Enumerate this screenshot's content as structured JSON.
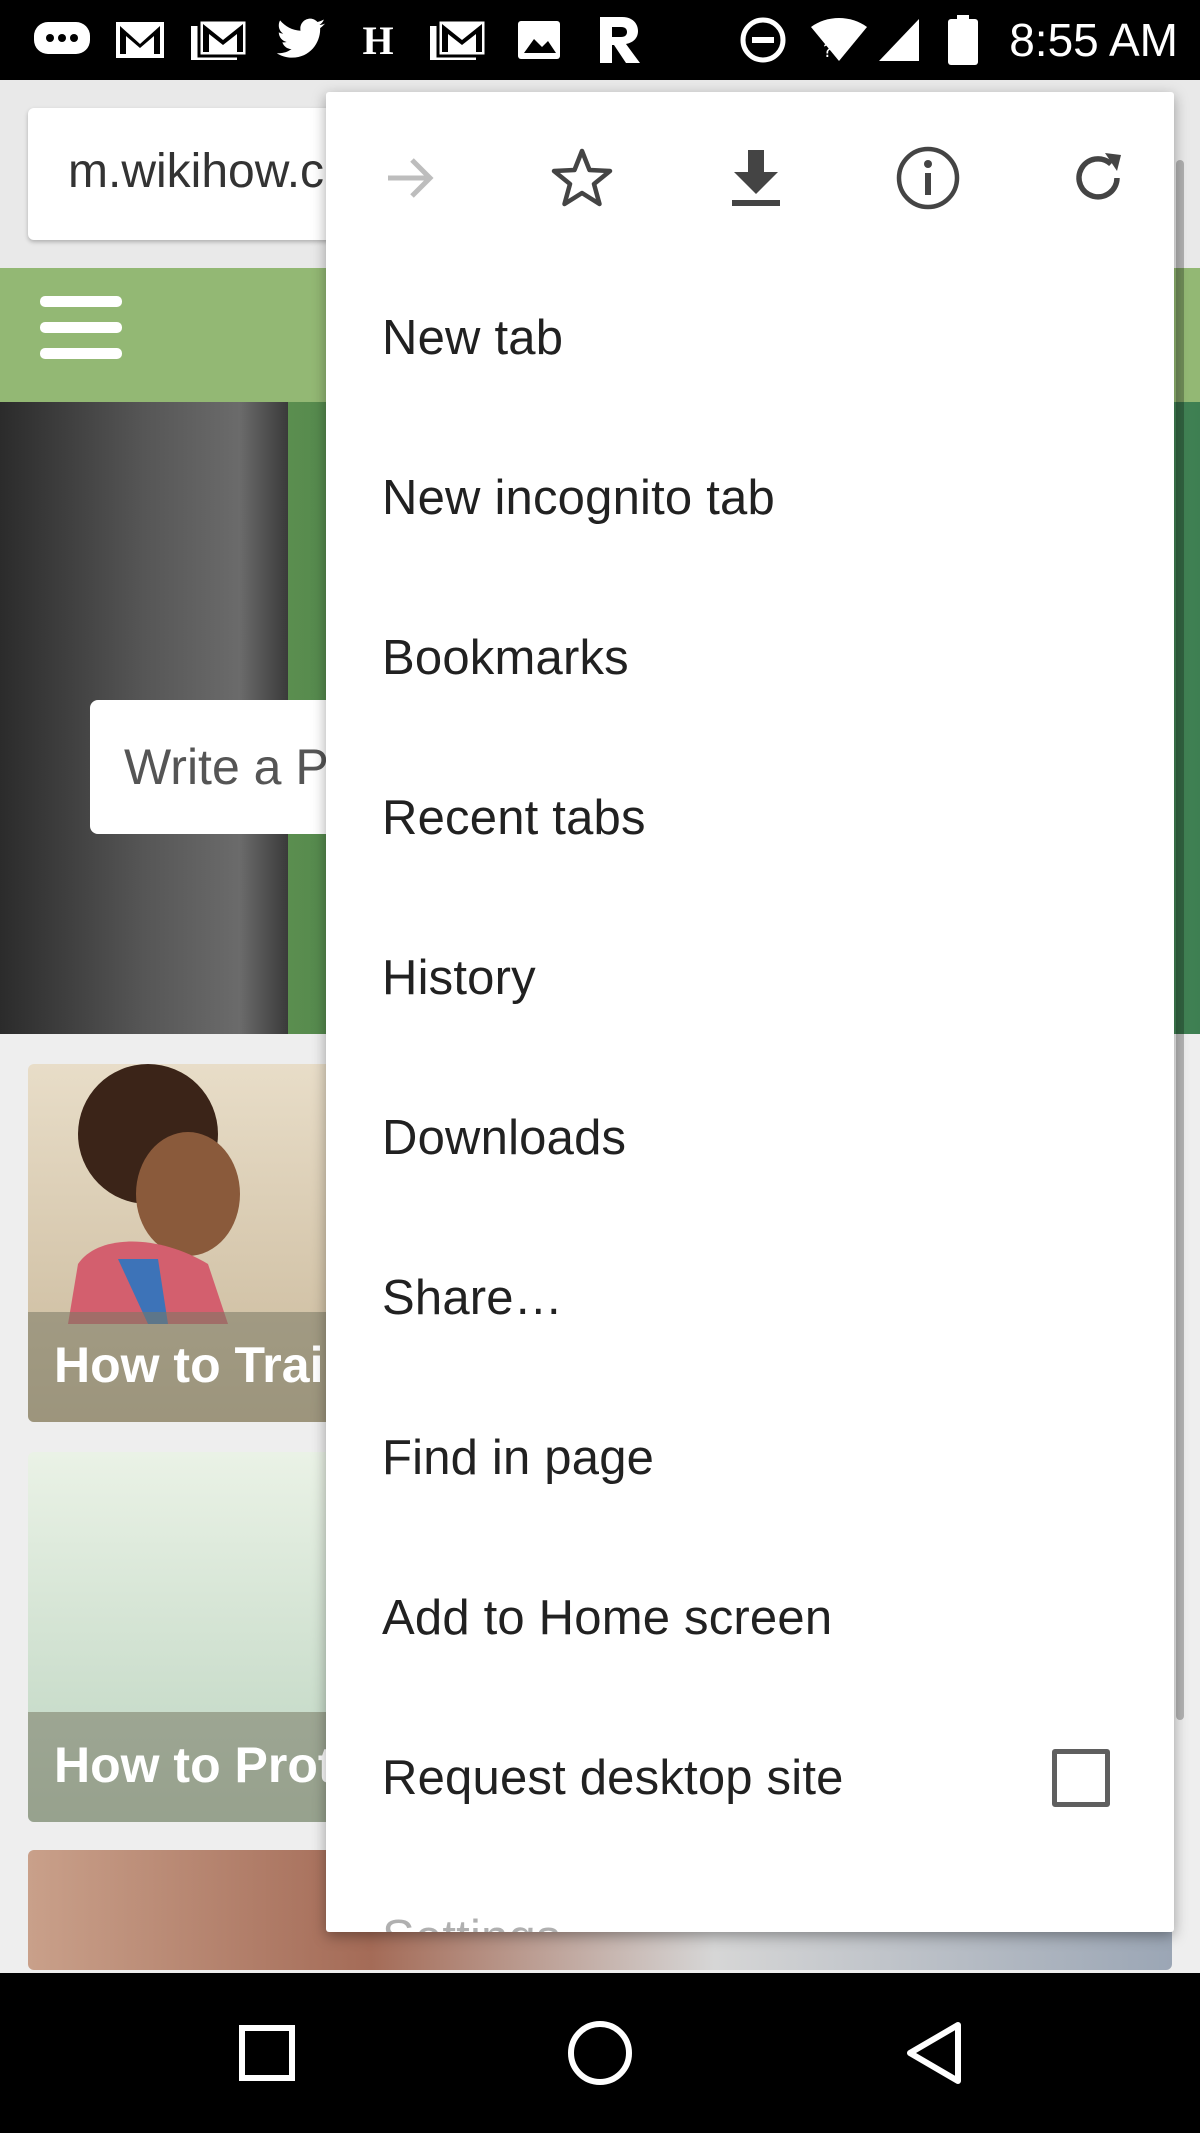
{
  "status_bar": {
    "time": "8:55 AM",
    "icons": [
      "messages-icon",
      "gmail-icon",
      "gmail-icon",
      "gmail-icon",
      "twitter-icon",
      "h-icon",
      "gmail-icon",
      "image-icon",
      "r-icon",
      "do-not-disturb-icon",
      "wifi-icon",
      "signal-icon",
      "battery-icon"
    ]
  },
  "browser": {
    "url": "m.wikihow.com"
  },
  "page": {
    "hero_search_placeholder": "Write a P",
    "cards": [
      {
        "title": "How to Trai"
      },
      {
        "title": "How to Prot"
      },
      {
        "title": ""
      }
    ]
  },
  "menu": {
    "icon_row": [
      {
        "name": "forward-icon",
        "enabled": false
      },
      {
        "name": "bookmark-star-icon",
        "enabled": true
      },
      {
        "name": "download-icon",
        "enabled": true
      },
      {
        "name": "info-icon",
        "enabled": true
      },
      {
        "name": "reload-icon",
        "enabled": true
      }
    ],
    "items": [
      {
        "label": "New tab"
      },
      {
        "label": "New incognito tab"
      },
      {
        "label": "Bookmarks"
      },
      {
        "label": "Recent tabs"
      },
      {
        "label": "History"
      },
      {
        "label": "Downloads"
      },
      {
        "label": "Share…"
      },
      {
        "label": "Find in page"
      },
      {
        "label": "Add to Home screen"
      },
      {
        "label": "Request desktop site",
        "checkbox": false
      },
      {
        "label": "Settings"
      }
    ]
  },
  "nav_bar": {
    "buttons": [
      "recents-icon",
      "home-icon",
      "back-icon"
    ]
  },
  "colors": {
    "wiki_green": "#93b874",
    "menu_bg": "#ffffff",
    "status_bar_bg": "#000000"
  }
}
